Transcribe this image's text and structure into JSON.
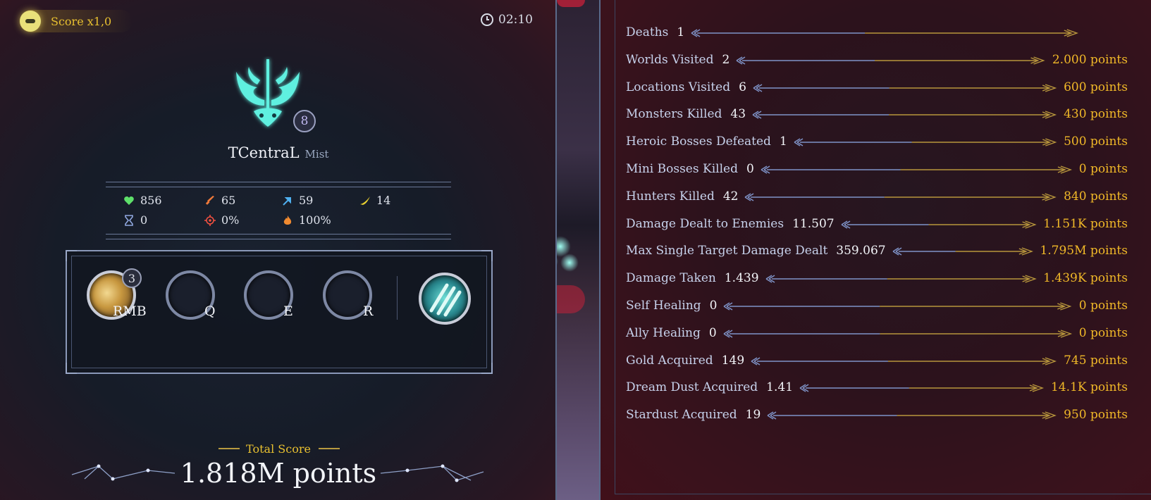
{
  "header": {
    "score_multiplier": "Score x1,0",
    "timer": "02:10"
  },
  "character": {
    "name": "TCentraL",
    "class_name": "Mist",
    "level": "8",
    "emblem_color": "#5ff0e0"
  },
  "stats": {
    "health": "856",
    "attack": "65",
    "speed": "59",
    "dash": "14",
    "cooldown": "0",
    "crit_chance": "0%",
    "fire_rate": "100%"
  },
  "abilities": [
    {
      "key": "RMB",
      "charges": "3",
      "filled": true
    },
    {
      "key": "Q",
      "filled": false
    },
    {
      "key": "E",
      "filled": false
    },
    {
      "key": "R",
      "filled": false
    }
  ],
  "total": {
    "label": "Total Score",
    "value": "1.818M points"
  },
  "score_rows": [
    {
      "label": "Deaths",
      "value": "1",
      "points": ""
    },
    {
      "label": "Worlds Visited",
      "value": "2",
      "points": "2.000 points"
    },
    {
      "label": "Locations Visited",
      "value": "6",
      "points": "600 points"
    },
    {
      "label": "Monsters Killed",
      "value": "43",
      "points": "430 points"
    },
    {
      "label": "Heroic Bosses Defeated",
      "value": "1",
      "points": "500 points"
    },
    {
      "label": "Mini Bosses Killed",
      "value": "0",
      "points": "0 points"
    },
    {
      "label": "Hunters Killed",
      "value": "42",
      "points": "840 points"
    },
    {
      "label": "Damage Dealt to Enemies",
      "value": "11.507",
      "points": "1.151K points"
    },
    {
      "label": "Max Single Target Damage Dealt",
      "value": "359.067",
      "points": "1.795M points"
    },
    {
      "label": "Damage Taken",
      "value": "1.439",
      "points": "1.439K points"
    },
    {
      "label": "Self Healing",
      "value": "0",
      "points": "0 points"
    },
    {
      "label": "Ally Healing",
      "value": "0",
      "points": "0 points"
    },
    {
      "label": "Gold Acquired",
      "value": "149",
      "points": "745 points"
    },
    {
      "label": "Dream Dust Acquired",
      "value": "1.41",
      "points": "14.1K points"
    },
    {
      "label": "Stardust Acquired",
      "value": "19",
      "points": "950 points"
    }
  ],
  "colors": {
    "gold": "#f0b828",
    "label": "#c7d2ec",
    "arrow_blue": "#7f93c8",
    "arrow_gold": "#b8963c"
  }
}
